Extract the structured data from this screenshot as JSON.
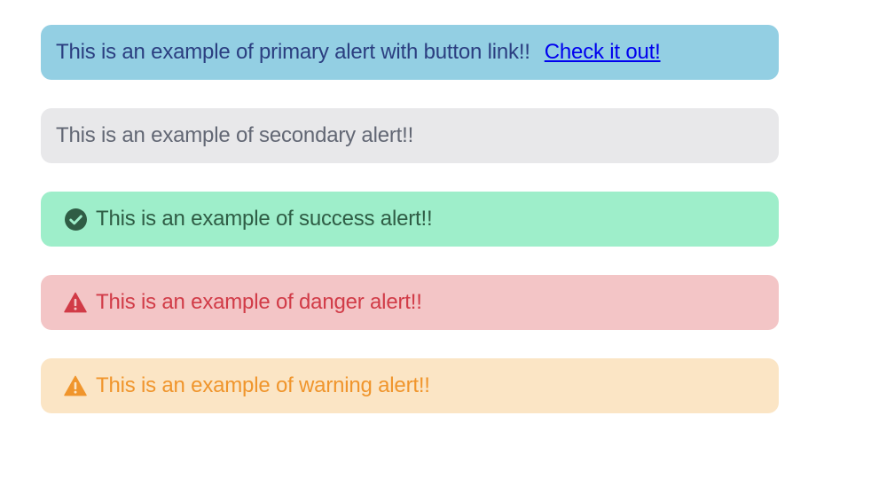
{
  "alerts": {
    "primary": {
      "text": "This is an example of primary alert with button link!!",
      "link_label": "Check it out!",
      "background": "#93cfe3",
      "color": "#2b3e80"
    },
    "secondary": {
      "text": "This is an example of secondary alert!!",
      "background": "#e8e8ea",
      "color": "#626774"
    },
    "success": {
      "icon": "check-circle-icon",
      "text": "This is an example of success alert!!",
      "background": "#9eeeca",
      "color": "#2f5d45"
    },
    "danger": {
      "icon": "warning-triangle-icon",
      "text": "This is an example of danger alert!!",
      "background": "#f3c5c6",
      "color": "#d13b47"
    },
    "warning": {
      "icon": "warning-triangle-icon",
      "text": "This is an example of warning alert!!",
      "background": "#fbe5c5",
      "color": "#f0952c"
    }
  }
}
